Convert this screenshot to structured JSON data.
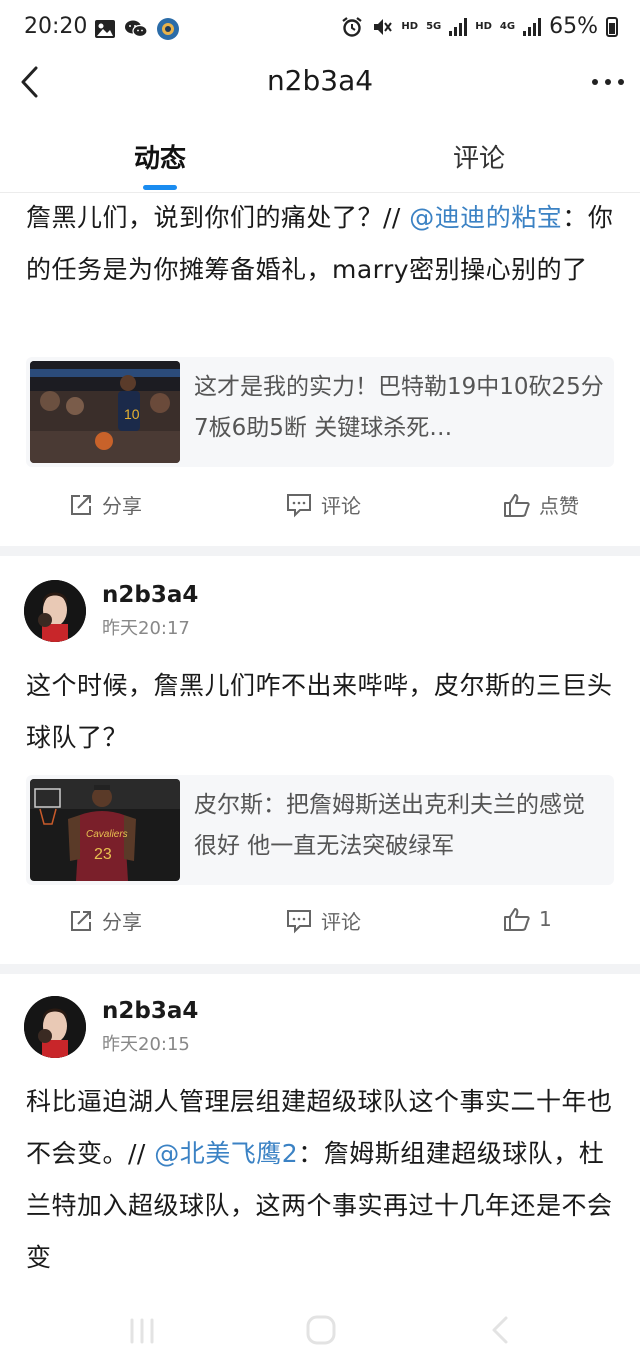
{
  "status_bar": {
    "time": "20:20",
    "hd1": "HD",
    "net1": "5G",
    "hd2": "HD",
    "net2": "4G",
    "battery": "65%"
  },
  "nav": {
    "title": "n2b3a4"
  },
  "tabs": [
    {
      "label": "动态",
      "active": true
    },
    {
      "label": "评论",
      "active": false
    }
  ],
  "posts": [
    {
      "text_parts": [
        "詹黑儿们，说到你们的痛处了？// ",
        "@迪迪的粘宝",
        "：你的任务是为你摊筹备婚礼，marry密别操心别的了"
      ],
      "card_title": "这才是我的实力！巴特勒19中10砍25分7板6助5断 关键球杀死…",
      "actions": {
        "share": "分享",
        "comment": "评论",
        "like": "点赞"
      }
    },
    {
      "author": "n2b3a4",
      "time": "昨天20:17",
      "text": "这个时候，詹黑儿们咋不出来哔哔，皮尔斯的三巨头球队了？",
      "card_title": "皮尔斯：把詹姆斯送出克利夫兰的感觉很好 他一直无法突破绿军",
      "actions": {
        "share": "分享",
        "comment": "评论",
        "like": "1"
      }
    },
    {
      "author": "n2b3a4",
      "time": "昨天20:15",
      "text_parts": [
        "科比逼迫湖人管理层组建超级球队这个事实二十年也不会变。// ",
        "@北美飞鹰2",
        "：詹姆斯组建超级球队，杜兰特加入超级球队，这两个事实再过十几年还是不会变"
      ]
    }
  ],
  "colors": {
    "accent": "#1a8cf0",
    "mention": "#3b82c4",
    "card_bg": "#f6f7f9"
  }
}
